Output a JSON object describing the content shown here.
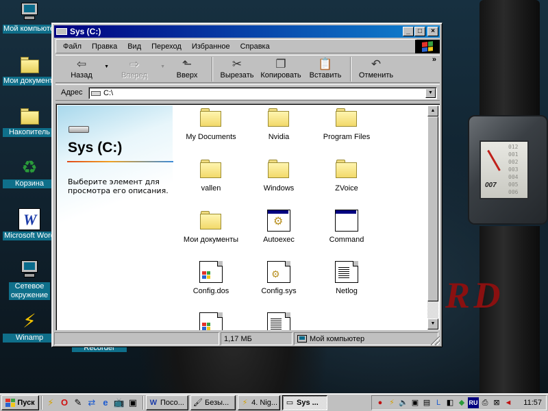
{
  "desktop": {
    "icons": [
      {
        "label": "Мой компьютер",
        "icon": "my-computer-icon"
      },
      {
        "label": "Мои документы",
        "icon": "my-documents-icon"
      },
      {
        "label": "Накопитель",
        "icon": "briefcase-icon"
      },
      {
        "label": "Корзина",
        "icon": "recycle-bin-icon"
      },
      {
        "label": "Microsoft Word",
        "icon": "word-icon"
      },
      {
        "label": "Сетевое окружение",
        "icon": "network-icon"
      },
      {
        "label": "Winamp",
        "icon": "winamp-icon"
      }
    ],
    "partial_label": "Recorder",
    "watch_numbers": [
      "012",
      "001",
      "002",
      "003",
      "004",
      "005",
      "006"
    ],
    "watch_brand": "007",
    "logo_text": "R D"
  },
  "window": {
    "title": "Sys (C:)",
    "controls": {
      "minimize": "_",
      "maximize": "□",
      "close": "×"
    },
    "menu": [
      "Файл",
      "Правка",
      "Вид",
      "Переход",
      "Избранное",
      "Справка"
    ],
    "toolbar": {
      "back": "Назад",
      "forward": "Вперед",
      "up": "Вверх",
      "cut": "Вырезать",
      "copy": "Копировать",
      "paste": "Вставить",
      "undo": "Отменить",
      "more": "»"
    },
    "address": {
      "label": "Адрес",
      "value": "C:\\"
    },
    "webview": {
      "title": "Sys (C:)",
      "description": "Выберите элемент для просмотра его описания."
    },
    "files": [
      {
        "name": "My Documents",
        "type": "folder"
      },
      {
        "name": "Nvidia",
        "type": "folder"
      },
      {
        "name": "Program Files",
        "type": "folder"
      },
      {
        "name": "vallen",
        "type": "folder"
      },
      {
        "name": "Windows",
        "type": "folder"
      },
      {
        "name": "ZVoice",
        "type": "folder"
      },
      {
        "name": "Мои документы",
        "type": "folder"
      },
      {
        "name": "Autoexec",
        "type": "batch"
      },
      {
        "name": "Command",
        "type": "app"
      },
      {
        "name": "Config.dos",
        "type": "windows-doc"
      },
      {
        "name": "Config.sys",
        "type": "system-doc"
      },
      {
        "name": "Netlog",
        "type": "text-doc"
      }
    ],
    "status": {
      "left": "",
      "size": "1,17 МБ",
      "location": "Мой компьютер"
    }
  },
  "taskbar": {
    "start": "Пуск",
    "quick_launch": [
      "winamp-icon",
      "opera-icon",
      "notepad-icon",
      "network-icon",
      "ie-icon",
      "tv-icon",
      "media-icon"
    ],
    "tasks": [
      {
        "label": "Посо...",
        "icon": "word-icon",
        "active": false
      },
      {
        "label": "Безы...",
        "icon": "paint-icon",
        "active": false
      },
      {
        "label": "4. Nig...",
        "icon": "winamp-icon",
        "active": false
      },
      {
        "label": "Sys ...",
        "icon": "drive-icon",
        "active": true
      }
    ],
    "tray": {
      "language": "RU",
      "clock": "11:57"
    }
  }
}
